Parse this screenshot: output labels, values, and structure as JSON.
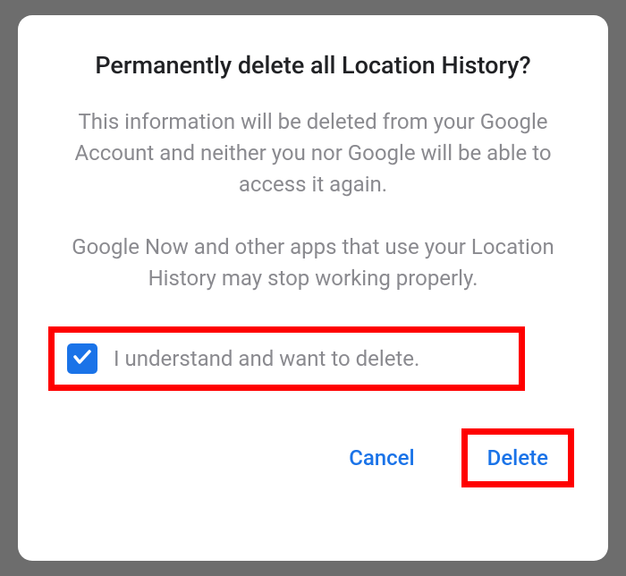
{
  "dialog": {
    "title": "Permanently delete all Location History?",
    "paragraph1": "This information will be deleted from your Google Account and neither you nor Google will be able to access it again.",
    "paragraph2": "Google Now and other apps that use your Location History may stop working properly.",
    "checkbox": {
      "checked": true,
      "label": "I understand and want to delete."
    },
    "actions": {
      "cancel": "Cancel",
      "delete": "Delete"
    }
  },
  "colors": {
    "accent": "#1a73e8",
    "highlight": "#ff0000"
  }
}
